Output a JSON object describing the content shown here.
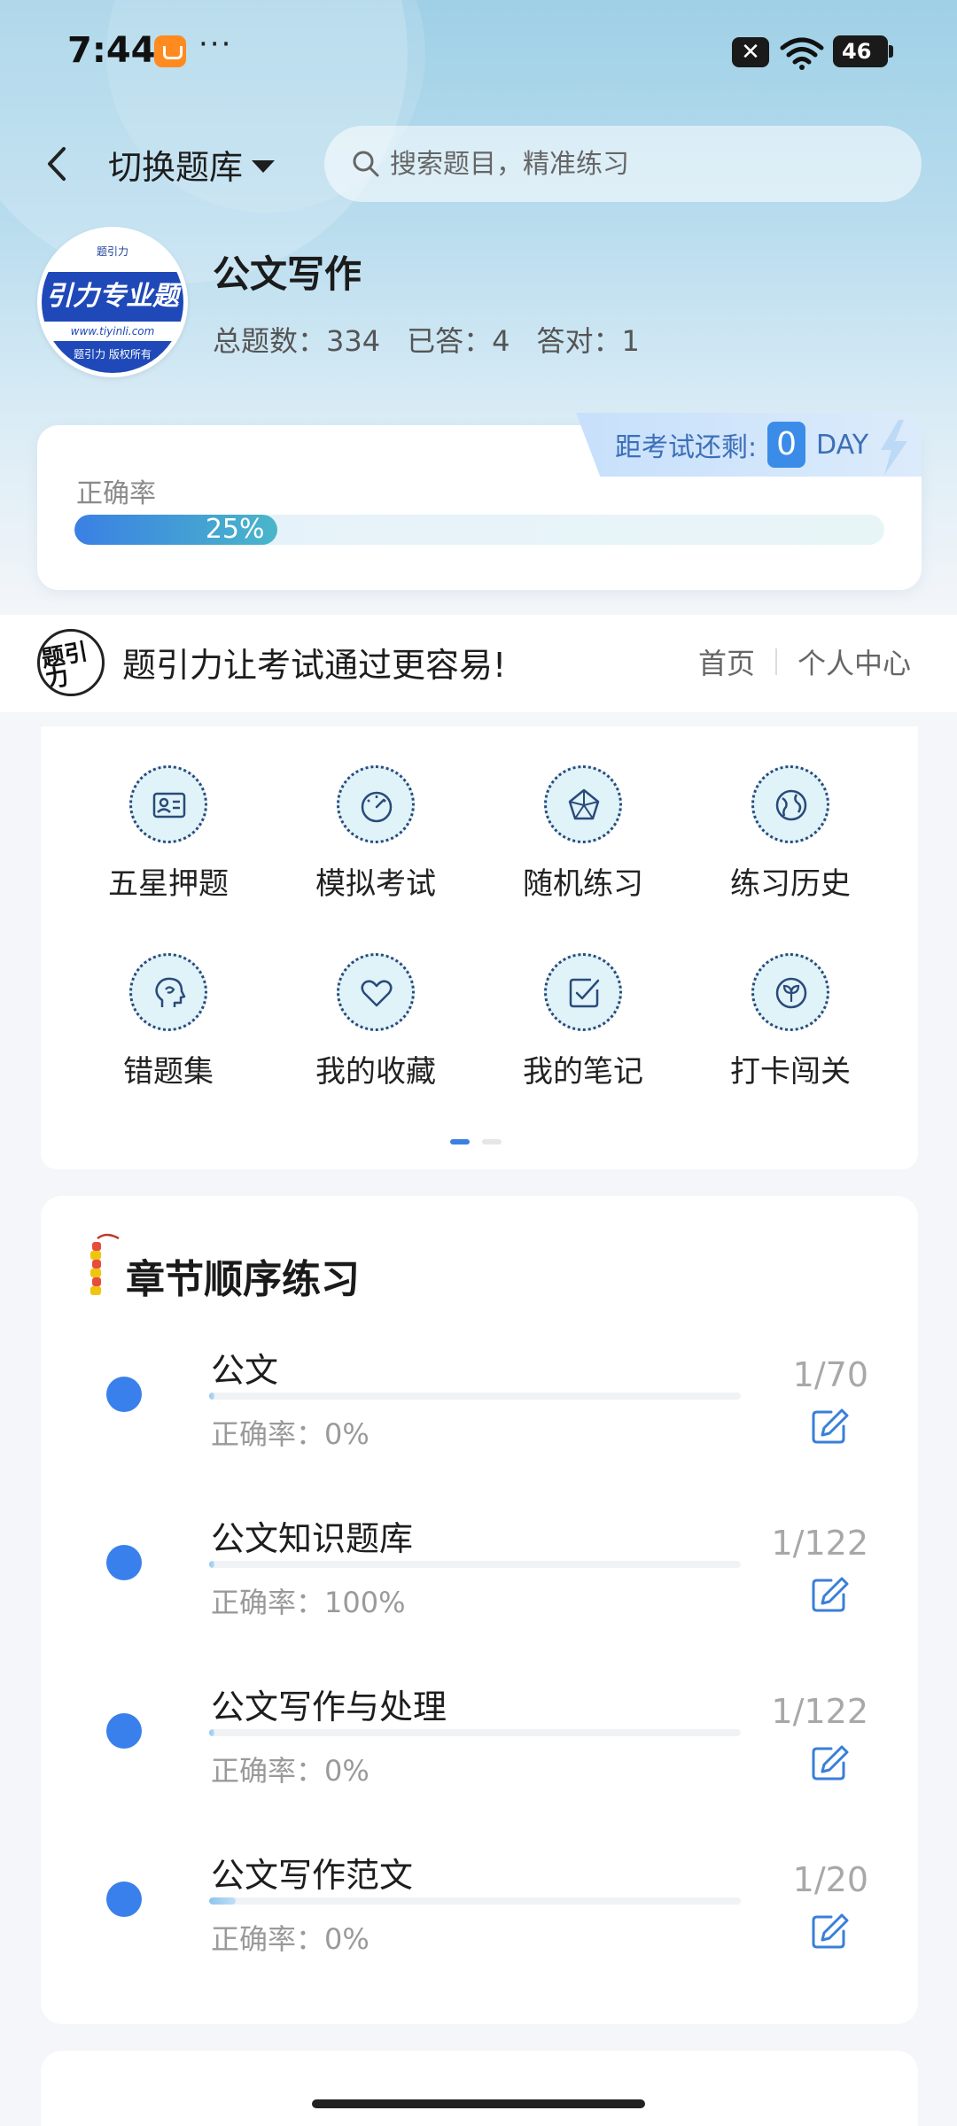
{
  "status_bar": {
    "time": "7:44",
    "dots": "···",
    "battery": "46",
    "x_glyph": "✕"
  },
  "header": {
    "switch_label": "切换题库",
    "search_placeholder": "搜索题目，精准练习"
  },
  "profile": {
    "avatar_top": "题引力",
    "avatar_band": "引力专业题",
    "avatar_url": "www.tiyinli.com",
    "avatar_bottom": "题引力 版权所有",
    "title": "公文写作",
    "stats": {
      "total": "总题数：334",
      "answered": "已答：4",
      "correct": "答对：1"
    }
  },
  "accuracy": {
    "label": "正确率",
    "percent_text": "25%",
    "percent": 25,
    "exam_label": "距考试还剩:",
    "days": "0",
    "day_unit": "DAY"
  },
  "slogan": {
    "logo_text": "题引力",
    "text": "题引力让考试通过更容易!",
    "nav_home": "首页",
    "nav_center": "个人中心"
  },
  "features": [
    {
      "label": "五星押题",
      "icon": "id-card-icon"
    },
    {
      "label": "模拟考试",
      "icon": "gauge-icon"
    },
    {
      "label": "随机练习",
      "icon": "network-icon"
    },
    {
      "label": "练习历史",
      "icon": "globe-icon"
    },
    {
      "label": "错题集",
      "icon": "head-icon"
    },
    {
      "label": "我的收藏",
      "icon": "heart-icon"
    },
    {
      "label": "我的笔记",
      "icon": "note-check-icon"
    },
    {
      "label": "打卡闯关",
      "icon": "leaf-badge-icon"
    }
  ],
  "chapters": {
    "title": "章节顺序练习",
    "items": [
      {
        "name": "公文",
        "accuracy": "正确率：0%",
        "count": "1/70",
        "progress": 0.01
      },
      {
        "name": "公文知识题库",
        "accuracy": "正确率：100%",
        "count": "1/122",
        "progress": 0.01
      },
      {
        "name": "公文写作与处理",
        "accuracy": "正确率：0%",
        "count": "1/122",
        "progress": 0.01
      },
      {
        "name": "公文写作范文",
        "accuracy": "正确率：0%",
        "count": "1/20",
        "progress": 0.05
      }
    ]
  },
  "colors": {
    "accent": "#3a80ec",
    "hero": "#9fd0e6",
    "progress_end": "#4ab6c9"
  }
}
